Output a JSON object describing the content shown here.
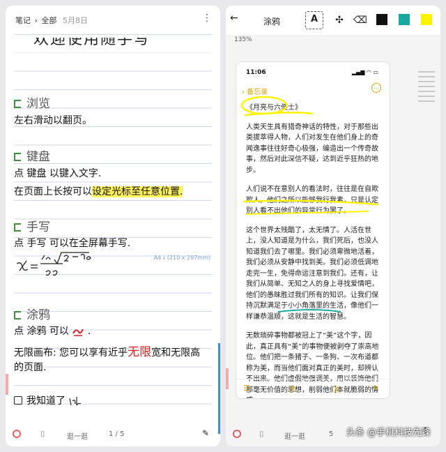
{
  "left": {
    "header": {
      "back": "‹",
      "notes": "笔记",
      "sep": "›",
      "all": "全部",
      "date": "5月8日",
      "more": "⋮"
    },
    "title": "欢迎使用随手写",
    "sections": [
      {
        "heading": "浏览",
        "lines": [
          "左右滑动以翻页。"
        ]
      },
      {
        "heading": "键盘",
        "lines": [
          "点 键盘 以键入文字.",
          "在页面上长按可以",
          "设定光标至任意位置."
        ]
      },
      {
        "heading": "手写",
        "lines": [
          "点 手写 可以在全屏幕手写."
        ]
      },
      {
        "heading": "涂鸦",
        "lines": [
          "点 涂鸦 可以",
          "."
        ]
      }
    ],
    "canvas_line_a": "无限画布: 您可以享有近乎",
    "canvas_red": "无限",
    "canvas_line_b": "宽和无限高",
    "canvas_line_c": "的页面.",
    "checkbox_label": "我知道了",
    "a4_label": "A4 ⤓ (210 x 297mm)",
    "footer": {
      "walk": "逛一逛",
      "page": "1 / 5"
    }
  },
  "right": {
    "toolbar": {
      "back": "←",
      "title": "涂鸦",
      "text_tool": "A",
      "colors": {
        "black": "#111111",
        "teal": "#1aa7a0",
        "yellow": "#fff200"
      }
    },
    "zoom": "135%",
    "phone": {
      "time": "11:06",
      "signal": "▂▄▆ ◠ ▭",
      "back": "‹ 备忘录",
      "more": "…",
      "paragraphs": [
        "《月亮与六便士》",
        "人类天生具有猎奇神话的特性，对于那些出类拔萃得人物，人们对发生在他们身上的奇闻逸事往往好奇心极强，编造出一个传奇故事，然后对此深信不疑，达到近乎狂热的地步。",
        "人们说不在意别人的看法时，往往是在自欺欺人。他们之所以能够我行我素，只是认定别人看不出他们的异常行为罢了。",
        "这个世界太残酷了，太无情了。人活在世上，没人知道是为什么，我们死后，也没人知道我们去了哪里。我们必须卑微地活着，我们必须从安静中找到美。我们必须低调地走完一生，免得命运注意到我们。还有，让我们从简单、无知之人的身上寻找爱情吧，他们的愚昧胜过我们所有的知识。让我们保持沉默满足于小小角落里的生活，像他们一样谦恭温顺，这就是生活的智慧。",
        "无数琐碎事物都被冠上了“美”这个字，因此，真正具有“美”的事物便被剥夺了崇高地位。他们把一条猪子、一条狗、一次布道都称为美，而当他们面对真正的美时，却辨认不出来。他们虚假地强调美，用以装饰他们那毫无价值的思想，削弱他们本就脆弱的情感。"
      ]
    },
    "footer": {
      "walk": "逛一逛",
      "page": "5"
    },
    "watermark": "头条 @手机科技先锋"
  }
}
